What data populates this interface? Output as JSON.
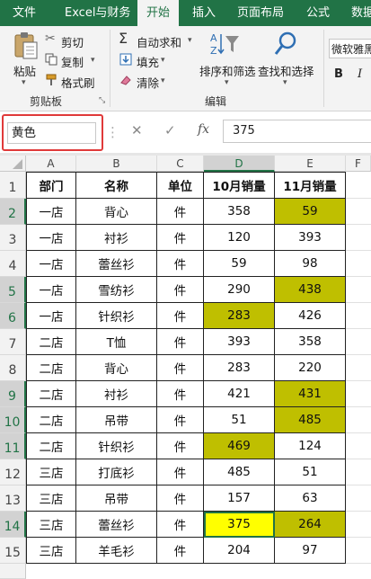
{
  "tabs": [
    "文件",
    "Excel与财务",
    "开始",
    "插入",
    "页面布局",
    "公式",
    "数据"
  ],
  "ribbon": {
    "clipboard": {
      "paste": "粘贴",
      "cut": "剪切",
      "copy": "复制",
      "format_painter": "格式刷",
      "group_label": "剪贴板"
    },
    "editing": {
      "autosum": "自动求和",
      "fill": "填充",
      "clear": "清除",
      "sort_filter": "排序和筛选",
      "find_select": "查找和选择",
      "group_label": "编辑"
    },
    "font": {
      "name": "微软雅黑",
      "bold": "B",
      "italic": "I"
    }
  },
  "formula_bar": {
    "name_box": "黄色",
    "cancel": "✕",
    "enter": "✓",
    "fx": "fx",
    "value": "375"
  },
  "columns": [
    "A",
    "B",
    "C",
    "D",
    "E",
    "F"
  ],
  "rows": [
    {
      "num": "1",
      "cells": [
        "部门",
        "名称",
        "单位",
        "10月销量",
        "11月销量"
      ]
    },
    {
      "num": "2",
      "cells": [
        "一店",
        "背心",
        "件",
        "358",
        "59"
      ]
    },
    {
      "num": "3",
      "cells": [
        "一店",
        "衬衫",
        "件",
        "120",
        "393"
      ]
    },
    {
      "num": "4",
      "cells": [
        "一店",
        "蕾丝衫",
        "件",
        "59",
        "98"
      ]
    },
    {
      "num": "5",
      "cells": [
        "一店",
        "雪纺衫",
        "件",
        "290",
        "438"
      ]
    },
    {
      "num": "6",
      "cells": [
        "一店",
        "针织衫",
        "件",
        "283",
        "426"
      ]
    },
    {
      "num": "7",
      "cells": [
        "二店",
        "T恤",
        "件",
        "393",
        "358"
      ]
    },
    {
      "num": "8",
      "cells": [
        "二店",
        "背心",
        "件",
        "283",
        "220"
      ]
    },
    {
      "num": "9",
      "cells": [
        "二店",
        "衬衫",
        "件",
        "421",
        "431"
      ]
    },
    {
      "num": "10",
      "cells": [
        "二店",
        "吊带",
        "件",
        "51",
        "485"
      ]
    },
    {
      "num": "11",
      "cells": [
        "二店",
        "针织衫",
        "件",
        "469",
        "124"
      ]
    },
    {
      "num": "12",
      "cells": [
        "三店",
        "打底衫",
        "件",
        "485",
        "51"
      ]
    },
    {
      "num": "13",
      "cells": [
        "三店",
        "吊带",
        "件",
        "157",
        "63"
      ]
    },
    {
      "num": "14",
      "cells": [
        "三店",
        "蕾丝衫",
        "件",
        "375",
        "264"
      ]
    },
    {
      "num": "15",
      "cells": [
        "三店",
        "羊毛衫",
        "件",
        "204",
        "97"
      ]
    }
  ],
  "selected_rows": [
    "2",
    "5",
    "6",
    "9",
    "10",
    "11",
    "14"
  ],
  "highlights": [
    {
      "cell": "E2",
      "color": "#bfbf00"
    },
    {
      "cell": "E5",
      "color": "#bfbf00"
    },
    {
      "cell": "D6",
      "color": "#bfbf00"
    },
    {
      "cell": "E9",
      "color": "#bfbf00"
    },
    {
      "cell": "E10",
      "color": "#bfbf00"
    },
    {
      "cell": "D11",
      "color": "#bfbf00"
    },
    {
      "cell": "D14",
      "color": "#ffff00"
    },
    {
      "cell": "E14",
      "color": "#bfbf00"
    }
  ],
  "active_cell": "D14",
  "accent_color": "#217346"
}
